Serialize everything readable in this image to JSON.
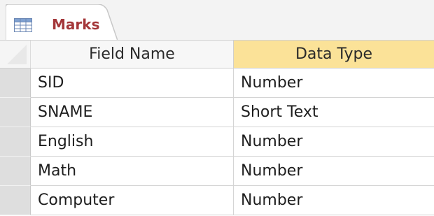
{
  "tab": {
    "label": "Marks",
    "icon": "table-icon",
    "label_color": "#a4373a"
  },
  "columns": {
    "field_name": "Field Name",
    "data_type": "Data Type",
    "active_header_color": "#fbe298"
  },
  "rows": [
    {
      "field_name": "SID",
      "data_type": "Number"
    },
    {
      "field_name": "SNAME",
      "data_type": "Short Text"
    },
    {
      "field_name": "English",
      "data_type": "Number"
    },
    {
      "field_name": "Math",
      "data_type": "Number"
    },
    {
      "field_name": "Computer",
      "data_type": "Number"
    }
  ]
}
